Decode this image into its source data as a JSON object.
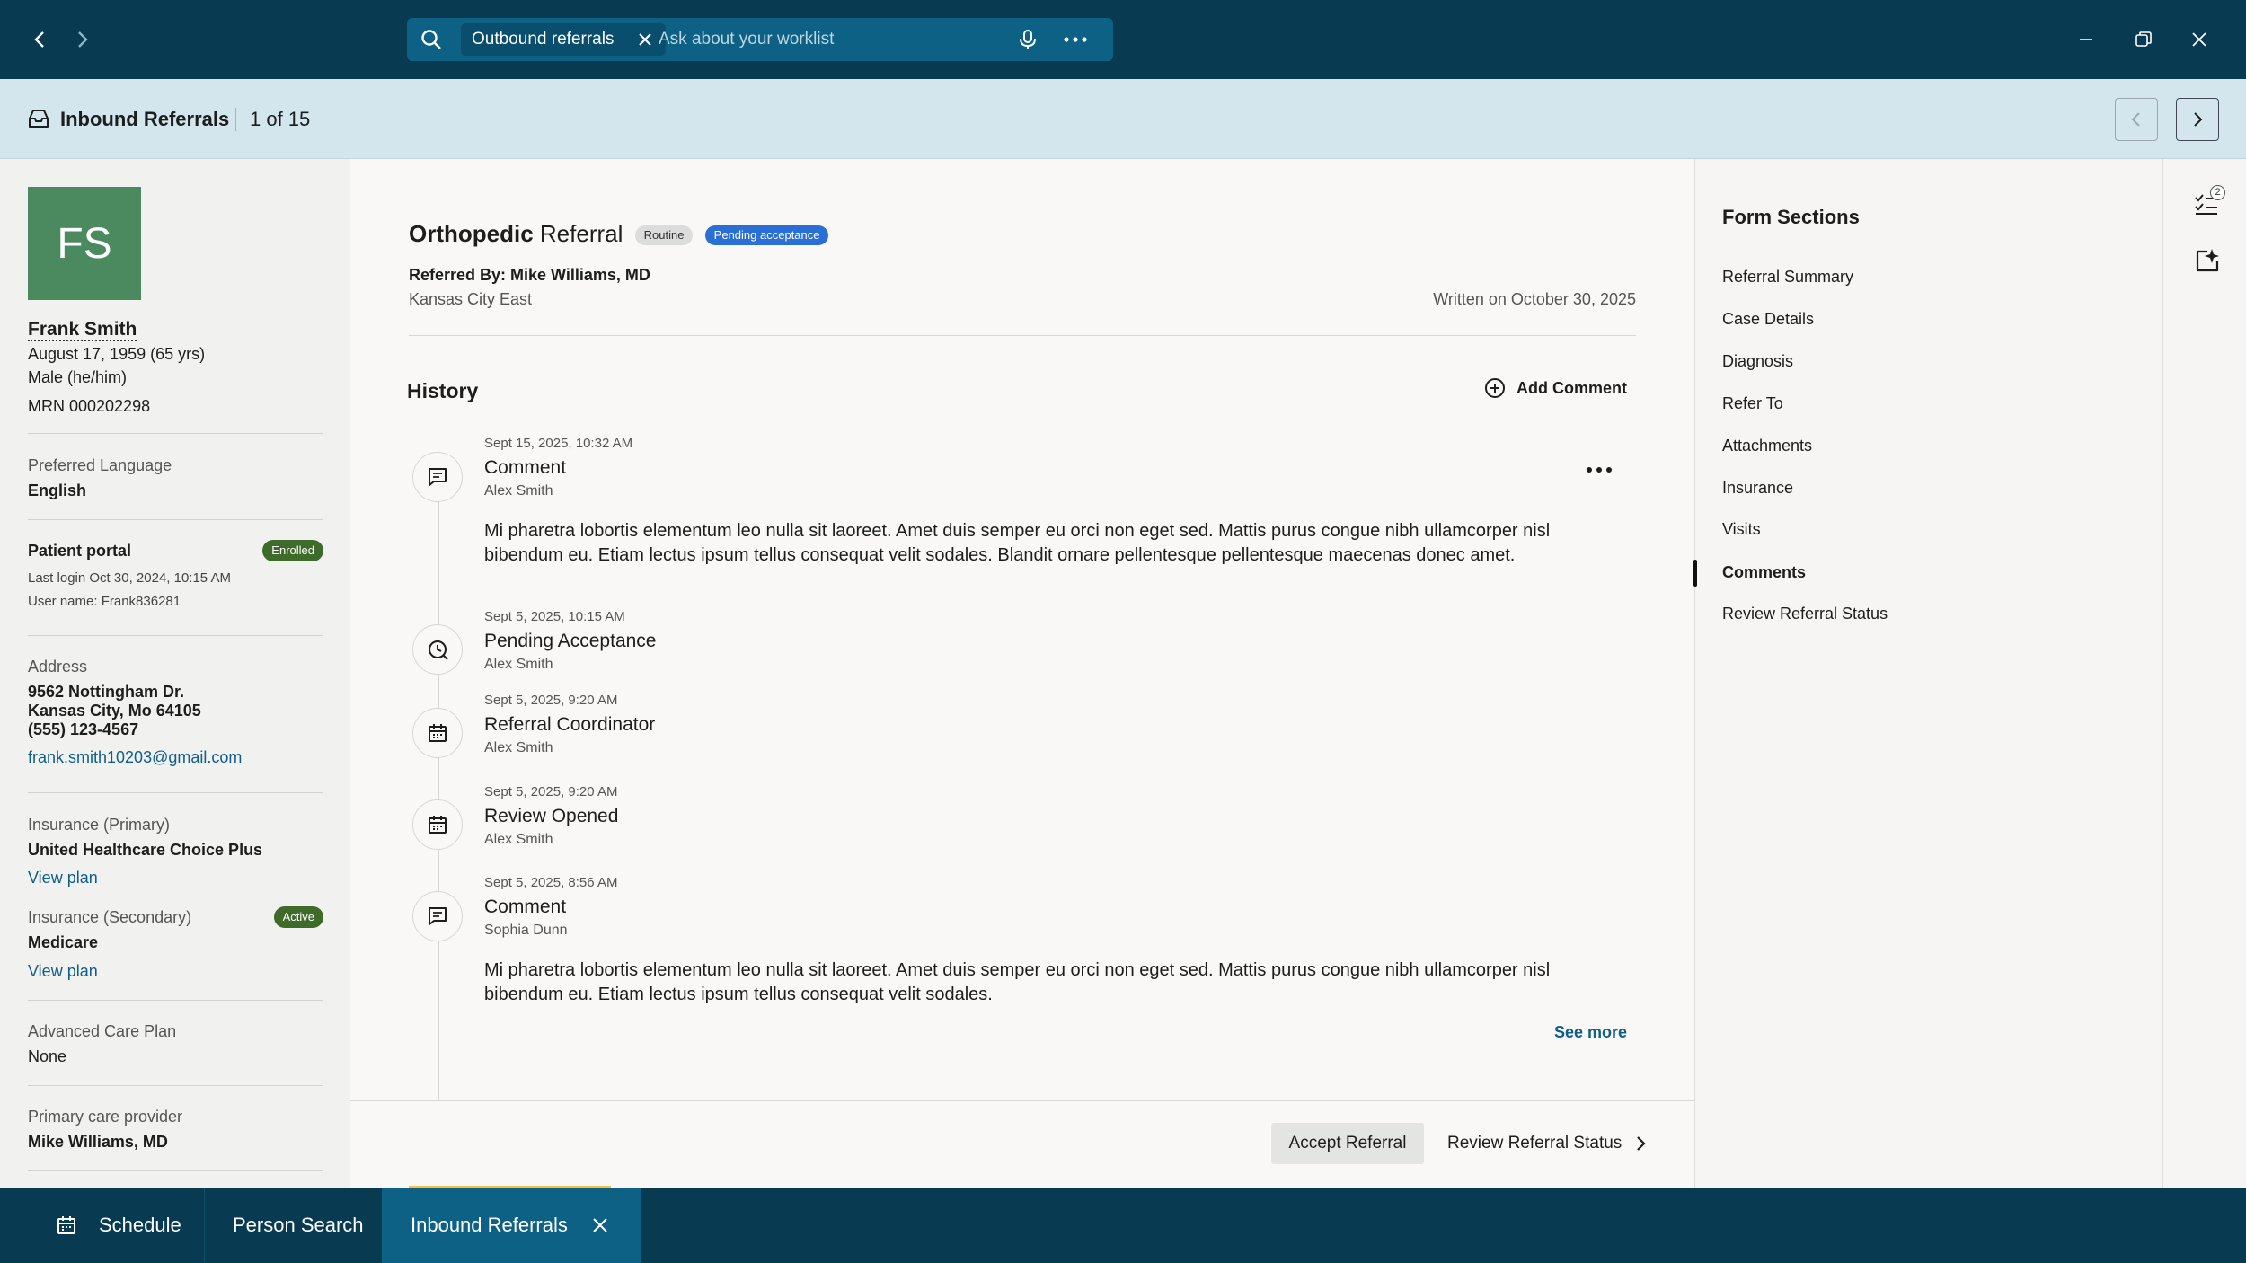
{
  "topbar": {
    "search_chip": "Outbound referrals",
    "search_placeholder": "Ask about your worklist",
    "icons": [
      "back-icon",
      "forward-icon",
      "search-icon",
      "close-icon",
      "microphone-icon",
      "more-icon",
      "minimize-icon",
      "restore-icon",
      "close-window-icon"
    ]
  },
  "subheader": {
    "title": "Inbound Referrals",
    "counter": "1 of 15"
  },
  "patient": {
    "initials": "FS",
    "name": "Frank Smith",
    "dob": "August 17, 1959 (65 yrs)",
    "sex": "Male (he/him)",
    "mrn": "MRN 000202298",
    "language_label": "Preferred Language",
    "language": "English",
    "portal_label": "Patient portal",
    "portal_badge": "Enrolled",
    "last_login": "Last login Oct 30, 2024, 10:15 AM",
    "username": "User name: Frank836281",
    "address_label": "Address",
    "address_line1": "9562 Nottingham Dr.",
    "address_line2": "Kansas City, Mo 64105",
    "phone": "(555) 123-4567",
    "email": "frank.smith10203@gmail.com",
    "ins_primary_label": "Insurance (Primary)",
    "ins_primary": "United Healthcare Choice Plus",
    "view_plan": "View plan",
    "ins_secondary_label": "Insurance (Secondary)",
    "ins_secondary_badge": "Active",
    "ins_secondary": "Medicare",
    "acp_label": "Advanced Care Plan",
    "acp": "None",
    "pcp_label": "Primary care provider",
    "pcp": "Mike Williams, MD",
    "badge_color": "#3e6a2a",
    "avatar_color": "#4a8a5e"
  },
  "referral": {
    "title_bold": "Orthopedic",
    "title_rest": "Referral",
    "tag_routine": "Routine",
    "tag_status": "Pending acceptance",
    "referred_by": "Referred By: Mike Williams, MD",
    "location": "Kansas City East",
    "written_on": "Written on October 30, 2025"
  },
  "history": {
    "heading": "History",
    "add_comment": "Add Comment",
    "see_more": "See more",
    "entries": [
      {
        "time": "Sept 15, 2025, 10:32 AM",
        "title": "Comment",
        "author": "Alex Smith",
        "icon": "comment-icon",
        "body": "Mi pharetra lobortis elementum leo nulla sit laoreet. Amet duis semper eu orci non eget sed. Mattis purus congue nibh ullamcorper nisl bibendum eu. Etiam lectus ipsum tellus consequat velit sodales. Blandit ornare pellentesque pellentesque maecenas  donec amet."
      },
      {
        "time": "Sept 5, 2025, 10:15 AM",
        "title": "Pending Acceptance",
        "author": "Alex Smith",
        "icon": "clock-icon"
      },
      {
        "time": "Sept 5, 2025, 9:20 AM",
        "title": "Referral Coordinator",
        "author": "Alex Smith",
        "icon": "calendar-icon"
      },
      {
        "time": "Sept 5, 2025, 9:20 AM",
        "title": "Review Opened",
        "author": "Alex Smith",
        "icon": "calendar-icon"
      },
      {
        "time": "Sept 5, 2025, 8:56 AM",
        "title": "Comment",
        "author": "Sophia Dunn",
        "icon": "comment-icon",
        "body": "Mi pharetra lobortis elementum leo nulla sit laoreet. Amet duis semper eu orci non eget sed. Mattis purus congue nibh ullamcorper nisl bibendum eu. Etiam lectus ipsum tellus consequat velit sodales."
      }
    ]
  },
  "actions": {
    "accept": "Accept Referral",
    "review": "Review Referral Status"
  },
  "form_sections": {
    "title": "Form Sections",
    "items": [
      "Referral Summary",
      "Case Details",
      "Diagnosis",
      "Refer To",
      "Attachments",
      "Insurance",
      "Visits",
      "Comments",
      "Review Referral Status"
    ],
    "active": "Comments"
  },
  "icon_rail": {
    "tasks_badge": "2"
  },
  "taskbar": {
    "tabs": [
      "Schedule",
      "Person Search",
      "Inbound Referrals"
    ],
    "active": "Inbound Referrals"
  },
  "colors": {
    "topbar": "#083a52",
    "search": "#0d6185",
    "subheader": "#d3e6ee",
    "link": "#0f5e8b",
    "tag_pending": "#2a6fd6",
    "active_tab": "#0d6185"
  }
}
